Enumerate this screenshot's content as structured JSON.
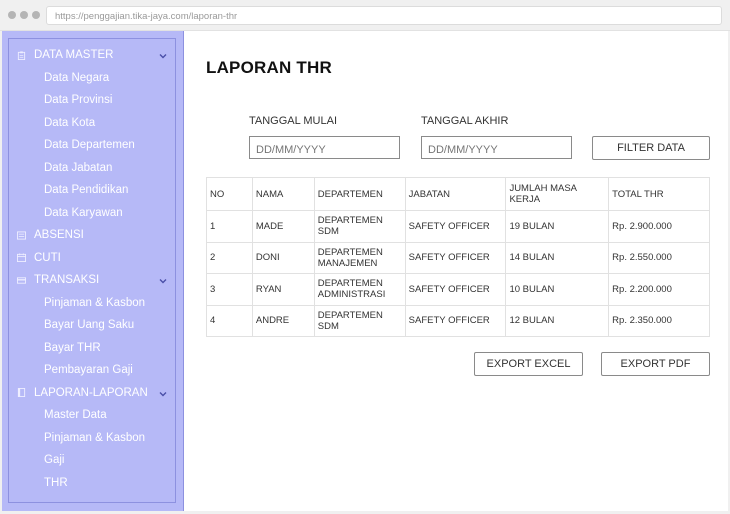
{
  "browser": {
    "url": "https://penggajian.tika-jaya.com/laporan-thr"
  },
  "sidebar": {
    "groups": [
      {
        "label": "DATA MASTER",
        "icon": "clipboard-icon",
        "items": [
          "Data Negara",
          "Data Provinsi",
          "Data Kota",
          "Data Departemen",
          "Data Jabatan",
          "Data Pendidikan",
          "Data Karyawan"
        ]
      },
      {
        "label": "ABSENSI",
        "icon": "list-icon",
        "items": []
      },
      {
        "label": "CUTI",
        "icon": "calendar-icon",
        "items": []
      },
      {
        "label": "TRANSAKSI",
        "icon": "card-icon",
        "items": [
          "Pinjaman & Kasbon",
          "Bayar Uang Saku",
          "Bayar THR",
          "Pembayaran Gaji"
        ]
      },
      {
        "label": "LAPORAN-LAPORAN",
        "icon": "book-icon",
        "items": [
          "Master Data",
          "Pinjaman & Kasbon",
          "Gaji",
          "THR"
        ]
      }
    ]
  },
  "main": {
    "title": "LAPORAN THR",
    "filter": {
      "start_label": "TANGGAL MULAI",
      "start_placeholder": "DD/MM/YYYY",
      "end_label": "TANGGAL AKHIR",
      "end_placeholder": "DD/MM/YYYY",
      "button_label": "FILTER DATA"
    },
    "table": {
      "columns": [
        "NO",
        "NAMA",
        "DEPARTEMEN",
        "JABATAN",
        "JUMLAH MASA KERJA",
        "TOTAL THR"
      ],
      "rows": [
        [
          "1",
          "MADE",
          "DEPARTEMEN SDM",
          "SAFETY OFFICER",
          "19 BULAN",
          "Rp. 2.900.000"
        ],
        [
          "2",
          "DONI",
          "DEPARTEMEN MANAJEMEN",
          "SAFETY OFFICER",
          "14 BULAN",
          "Rp. 2.550.000"
        ],
        [
          "3",
          "RYAN",
          "DEPARTEMEN ADMINISTRASI",
          "SAFETY OFFICER",
          "10 BULAN",
          "Rp. 2.200.000"
        ],
        [
          "4",
          "ANDRE",
          "DEPARTEMEN SDM",
          "SAFETY OFFICER",
          "12 BULAN",
          "Rp. 2.350.000"
        ]
      ]
    },
    "export": {
      "excel_label": "EXPORT EXCEL",
      "pdf_label": "EXPORT PDF"
    }
  },
  "colors": {
    "sidebar_bg": "#b6b9f7",
    "sidebar_border": "#8d91e0",
    "sidebar_text": "#ffffff"
  }
}
